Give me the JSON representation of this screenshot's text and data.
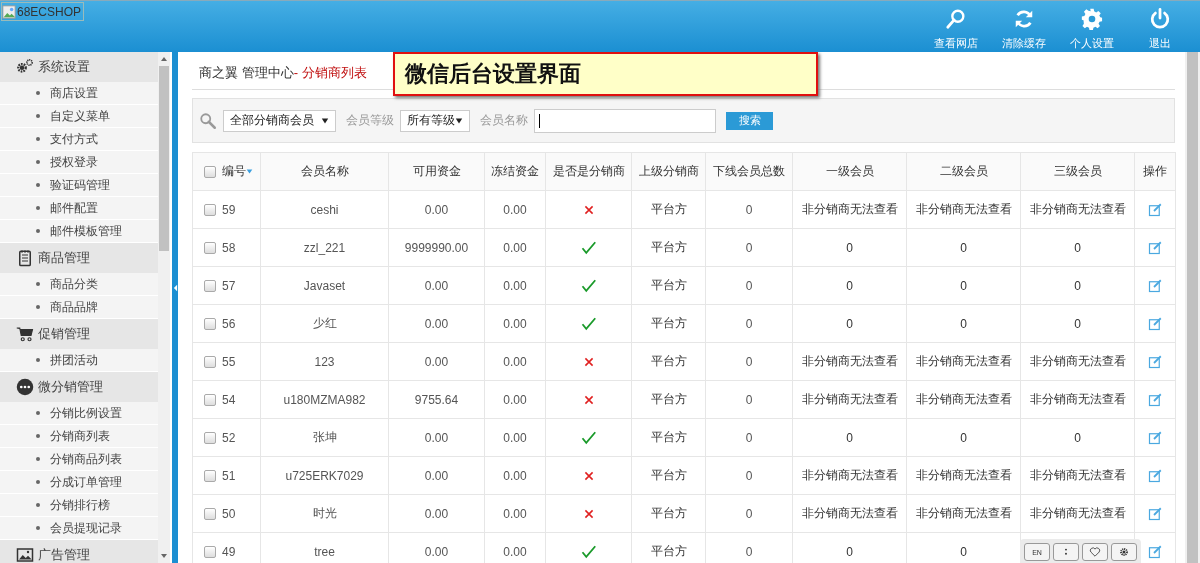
{
  "header": {
    "logo_alt": "68ECSHOP",
    "actions": [
      {
        "label": "查看网店",
        "kind": "search"
      },
      {
        "label": "清除缓存",
        "kind": "refresh"
      },
      {
        "label": "个人设置",
        "kind": "gear"
      },
      {
        "label": "退出",
        "kind": "power"
      }
    ]
  },
  "sidebar": {
    "groups": [
      {
        "title": "系统设置",
        "kind": "gears",
        "items": [
          "商店设置",
          "自定义菜单",
          "支付方式",
          "授权登录",
          "验证码管理",
          "邮件配置",
          "邮件模板管理"
        ]
      },
      {
        "title": "商品管理",
        "kind": "notepad",
        "items": [
          "商品分类",
          "商品品牌"
        ]
      },
      {
        "title": "促销管理",
        "kind": "cart",
        "items": [
          "拼团活动"
        ]
      },
      {
        "title": "微分销管理",
        "kind": "dots",
        "items": [
          "分销比例设置",
          "分销商列表",
          "分销商品列表",
          "分成订单管理",
          "分销排行榜",
          "会员提现记录"
        ]
      },
      {
        "title": "广告管理",
        "kind": "image"
      }
    ]
  },
  "breadcrumb": {
    "prefix": "商之翼 管理中心",
    "current": "- 分销商列表"
  },
  "annotation": "微信后台设置界面",
  "filter": {
    "type_select": "全部分销商会员",
    "level_label": "会员等级",
    "level_select": "所有等级",
    "name_label": "会员名称",
    "search_button": "搜索"
  },
  "table": {
    "select_all_checked": false,
    "columns": [
      {
        "label": "编号",
        "sorted": true
      },
      {
        "label": "会员名称"
      },
      {
        "label": "可用资金"
      },
      {
        "label": "冻结资金"
      },
      {
        "label": "是否是分销商"
      },
      {
        "label": "上级分销商"
      },
      {
        "label": "下线会员总数"
      },
      {
        "label": "一级会员"
      },
      {
        "label": "二级会员"
      },
      {
        "label": "三级会员"
      },
      {
        "label": "操作"
      }
    ],
    "rows": [
      {
        "id": "59",
        "checked": false,
        "name": "ceshi",
        "available": "0.00",
        "frozen": "0.00",
        "distributor": false,
        "parent": "平台方",
        "downline_total": "0",
        "level1": "非分销商无法查看",
        "level2": "非分销商无法查看",
        "level3": "非分销商无法查看"
      },
      {
        "id": "58",
        "checked": false,
        "name": "zzl_221",
        "available": "9999990.00",
        "frozen": "0.00",
        "distributor": true,
        "parent": "平台方",
        "downline_total": "0",
        "level1": "0",
        "level2": "0",
        "level3": "0"
      },
      {
        "id": "57",
        "checked": false,
        "name": "Javaset",
        "available": "0.00",
        "frozen": "0.00",
        "distributor": true,
        "parent": "平台方",
        "downline_total": "0",
        "level1": "0",
        "level2": "0",
        "level3": "0"
      },
      {
        "id": "56",
        "checked": false,
        "name": "少红",
        "available": "0.00",
        "frozen": "0.00",
        "distributor": true,
        "parent": "平台方",
        "downline_total": "0",
        "level1": "0",
        "level2": "0",
        "level3": "0"
      },
      {
        "id": "55",
        "checked": false,
        "name": "123",
        "available": "0.00",
        "frozen": "0.00",
        "distributor": false,
        "parent": "平台方",
        "downline_total": "0",
        "level1": "非分销商无法查看",
        "level2": "非分销商无法查看",
        "level3": "非分销商无法查看"
      },
      {
        "id": "54",
        "checked": false,
        "name": "u180MZMA982",
        "available": "9755.64",
        "frozen": "0.00",
        "distributor": false,
        "parent": "平台方",
        "downline_total": "0",
        "level1": "非分销商无法查看",
        "level2": "非分销商无法查看",
        "level3": "非分销商无法查看"
      },
      {
        "id": "52",
        "checked": false,
        "name": "张坤",
        "available": "0.00",
        "frozen": "0.00",
        "distributor": true,
        "parent": "平台方",
        "downline_total": "0",
        "level1": "0",
        "level2": "0",
        "level3": "0"
      },
      {
        "id": "51",
        "checked": false,
        "name": "u725ERK7029",
        "available": "0.00",
        "frozen": "0.00",
        "distributor": false,
        "parent": "平台方",
        "downline_total": "0",
        "level1": "非分销商无法查看",
        "level2": "非分销商无法查看",
        "level3": "非分销商无法查看"
      },
      {
        "id": "50",
        "checked": false,
        "name": "时光",
        "available": "0.00",
        "frozen": "0.00",
        "distributor": false,
        "parent": "平台方",
        "downline_total": "0",
        "level1": "非分销商无法查看",
        "level2": "非分销商无法查看",
        "level3": "非分销商无法查看"
      },
      {
        "id": "49",
        "checked": false,
        "name": "tree",
        "available": "0.00",
        "frozen": "0.00",
        "distributor": true,
        "parent": "平台方",
        "downline_total": "0",
        "level1": "0",
        "level2": "0"
      }
    ]
  },
  "floating_toolbar": [
    {
      "kind": "text",
      "label": "EN"
    },
    {
      "kind": "more"
    },
    {
      "kind": "heart"
    },
    {
      "kind": "gear"
    }
  ]
}
